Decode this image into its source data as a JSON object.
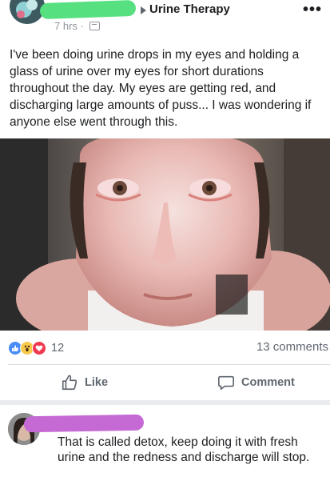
{
  "post": {
    "group_name": "Urine Therapy",
    "timestamp": "7 hrs",
    "separator": "·",
    "more_label": "•••",
    "text": "I've been doing urine drops in my eyes and holding a glass of urine over my eyes for short durations throughout the day. My eyes are getting red, and discharging large amounts of puss... I was wondering if anyone else went through this.",
    "icons": {
      "arrow": "right-triangle-icon",
      "audience": "group-audience-icon",
      "more": "more-options-icon"
    }
  },
  "engagement": {
    "reaction_count": "12",
    "comment_count": "13 comments",
    "reaction_types": [
      "like",
      "wow",
      "love"
    ]
  },
  "actions": {
    "like_label": "Like",
    "comment_label": "Comment"
  },
  "comment": {
    "text": "That is called detox, keep doing it with fresh urine and the redness and discharge will stop."
  },
  "colors": {
    "name_redaction": "#57e07f",
    "comment_name_redaction": "#c56ad4",
    "like_blue": "#4a8cf7",
    "wow_yellow": "#f7c94b",
    "love_red": "#f0384f",
    "secondary_text": "#606770"
  }
}
